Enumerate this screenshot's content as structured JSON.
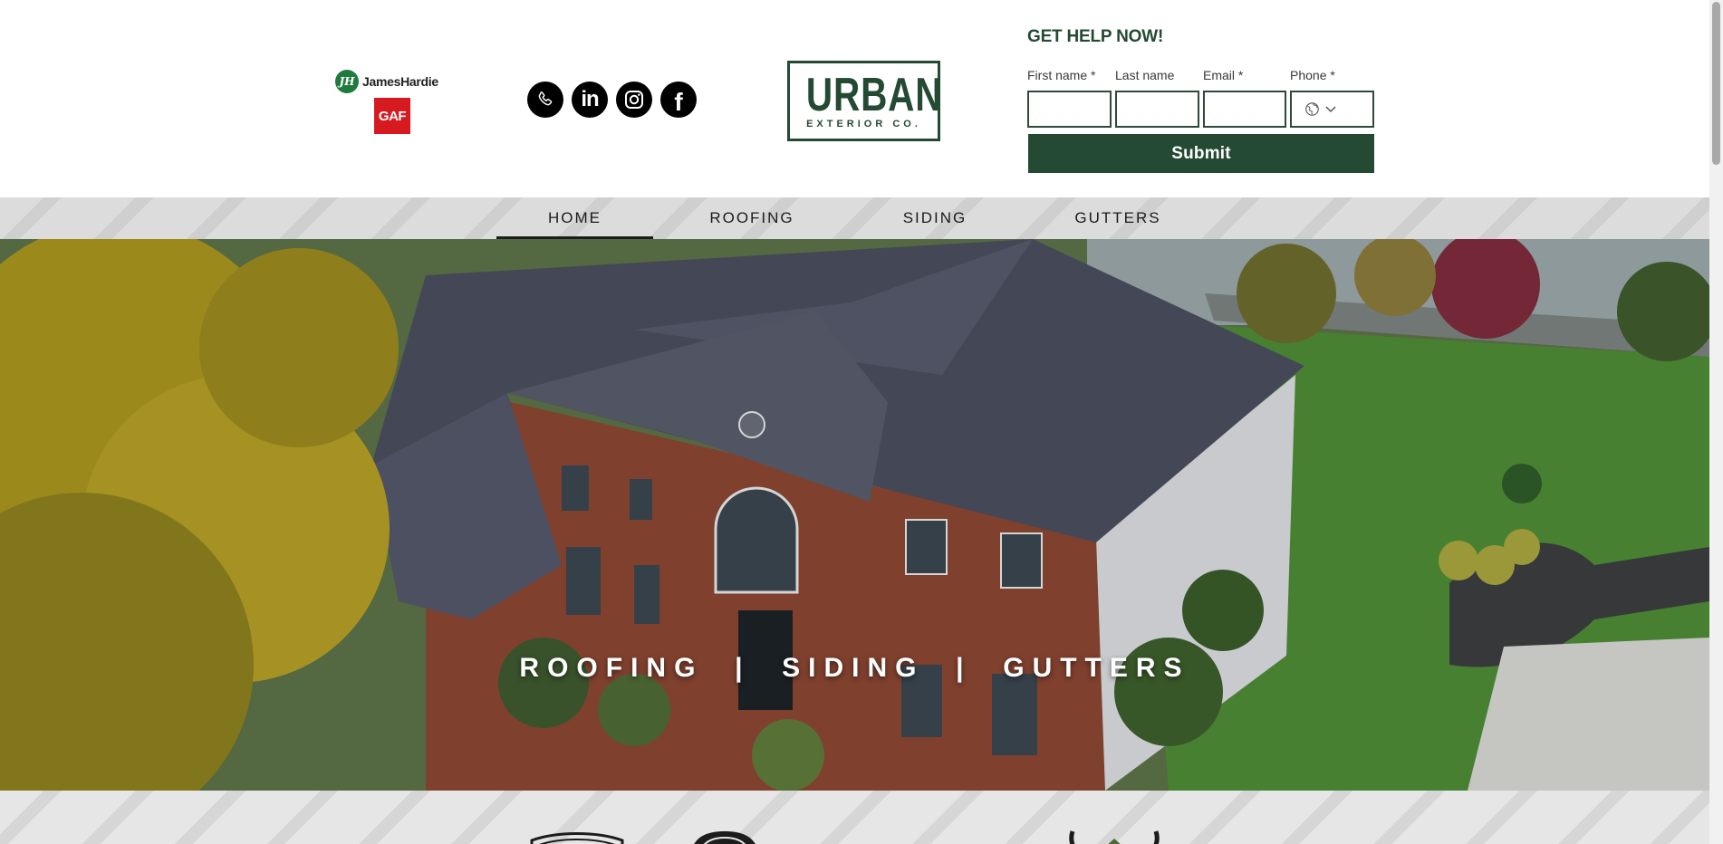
{
  "partners": {
    "james_hardie": {
      "mark": "JH",
      "name": "JamesHardie"
    },
    "gaf": "GAF"
  },
  "socials": [
    {
      "icon": "phone-icon"
    },
    {
      "icon": "linkedin-icon",
      "glyph": "in"
    },
    {
      "icon": "instagram-icon"
    },
    {
      "icon": "facebook-icon",
      "glyph": "f"
    }
  ],
  "brand": {
    "word": "URBAN",
    "sub": "EXTERIOR CO."
  },
  "form": {
    "title": "GET HELP NOW!",
    "first_name_label": "First name *",
    "last_name_label": "Last name",
    "email_label": "Email *",
    "phone_label": "Phone *",
    "phone_icon": "globe-icon",
    "submit_label": "Submit"
  },
  "nav": {
    "items": [
      {
        "label": "HOME",
        "active": true
      },
      {
        "label": "ROOFING"
      },
      {
        "label": "SIDING"
      },
      {
        "label": "GUTTERS"
      }
    ]
  },
  "hero": {
    "tagline": "ROOFING  |  SIDING  |  GUTTERS"
  },
  "colors": {
    "brand_green": "#244a33",
    "gaf_red": "#d71920",
    "jh_green": "#1f7a3e",
    "nav_gray": "#dcdcdc"
  }
}
